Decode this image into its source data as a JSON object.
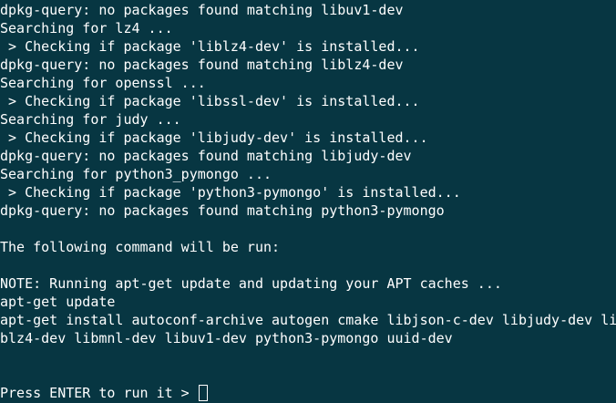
{
  "terminal": {
    "background": "#073642",
    "foreground": "#ffffff",
    "lines": [
      "dpkg-query: no packages found matching libuv1-dev",
      "Searching for lz4 ...",
      " > Checking if package 'liblz4-dev' is installed...",
      "dpkg-query: no packages found matching liblz4-dev",
      "Searching for openssl ...",
      " > Checking if package 'libssl-dev' is installed...",
      "Searching for judy ...",
      " > Checking if package 'libjudy-dev' is installed...",
      "dpkg-query: no packages found matching libjudy-dev",
      "Searching for python3_pymongo ...",
      " > Checking if package 'python3-pymongo' is installed...",
      "dpkg-query: no packages found matching python3-pymongo",
      "",
      "The following command will be run:",
      "",
      "NOTE: Running apt-get update and updating your APT caches ...",
      "apt-get update",
      "apt-get install autoconf-archive autogen cmake libjson-c-dev libjudy-dev li",
      "blz4-dev libmnl-dev libuv1-dev python3-pymongo uuid-dev",
      "",
      ""
    ],
    "prompt": "Press ENTER to run it > "
  }
}
